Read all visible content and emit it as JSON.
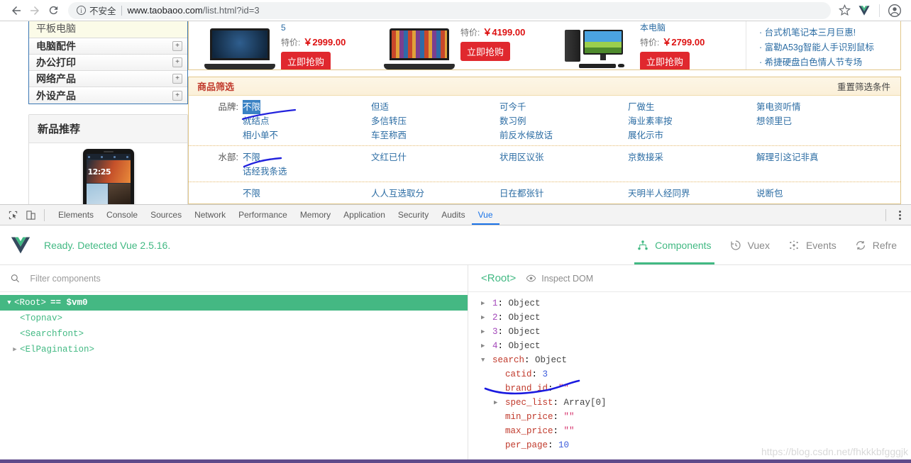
{
  "browser": {
    "back_icon": "arrow-left-icon",
    "forward_icon": "arrow-right-icon",
    "reload_icon": "reload-icon",
    "info_icon": "info-circle-icon",
    "security_label": "不安全",
    "url_host": "www.taobaoo.com",
    "url_path": "/list.html?id=3",
    "bookmark_icon": "star-icon",
    "extension_icon": "vue-devtools-extension-icon",
    "profile_icon": "profile-avatar-icon"
  },
  "sidebar": {
    "first_item": "平板电脑",
    "categories": [
      {
        "label": "电脑配件",
        "expand": "+"
      },
      {
        "label": "办公打印",
        "expand": "+"
      },
      {
        "label": "网络产品",
        "expand": "+"
      },
      {
        "label": "外设产品",
        "expand": "+"
      }
    ],
    "new_products": {
      "title": "新品推荐",
      "tablet_clock": "12:25"
    }
  },
  "promos": {
    "items": [
      {
        "name": "5",
        "price_label": "特价:",
        "price": "￥2999.00",
        "buy_label": "立即抢购",
        "art": "laptop-blue"
      },
      {
        "name": "",
        "price_label": "特价:",
        "price": "￥4199.00",
        "buy_label": "立即抢购",
        "art": "laptop-color"
      },
      {
        "name": "本电脑",
        "price_label": "特价:",
        "price": "￥2799.00",
        "buy_label": "立即抢购",
        "art": "desktop"
      }
    ],
    "side_links": [
      "台式机笔记本三月巨惠!",
      "富勒A53g智能人手识别鼠标",
      "希捷硬盘白色情人节专场"
    ]
  },
  "filter": {
    "title": "商品筛选",
    "reset_label": "重置筛选条件",
    "rows": [
      {
        "label": "品牌:",
        "columns": [
          {
            "options": [
              "不限",
              "就结点",
              "相小单不"
            ],
            "selected_index": 0
          },
          {
            "options": [
              "但适",
              "多信转压",
              "车至称西"
            ],
            "selected_index": -1
          },
          {
            "options": [
              "可今千",
              "数习例",
              "前反水候放话"
            ],
            "selected_index": -1
          },
          {
            "options": [
              "厂做生",
              "海业素率按",
              "展化示市"
            ],
            "selected_index": -1
          },
          {
            "options": [
              "第电资听情",
              "想领里已"
            ],
            "selected_index": -1
          }
        ]
      },
      {
        "label": "水部:",
        "columns": [
          {
            "options": [
              "不限",
              "话经我条选"
            ],
            "selected_index": -1
          },
          {
            "options": [
              "文红已什"
            ],
            "selected_index": -1
          },
          {
            "options": [
              "状用区议张"
            ],
            "selected_index": -1
          },
          {
            "options": [
              "京数接采"
            ],
            "selected_index": -1
          },
          {
            "options": [
              "解理引这记非真"
            ],
            "selected_index": -1
          }
        ]
      },
      {
        "label": "",
        "columns": [
          {
            "options": [
              "不限"
            ],
            "selected_index": -1
          },
          {
            "options": [
              "人人互选取分"
            ],
            "selected_index": -1
          },
          {
            "options": [
              "日在都张针"
            ],
            "selected_index": -1
          },
          {
            "options": [
              "天明半人经同界"
            ],
            "selected_index": -1
          },
          {
            "options": [
              "说断包"
            ],
            "selected_index": -1
          }
        ]
      }
    ]
  },
  "devtools": {
    "inspect_icon": "inspect-element-icon",
    "device_icon": "device-toolbar-icon",
    "tabs": [
      "Elements",
      "Console",
      "Sources",
      "Network",
      "Performance",
      "Memory",
      "Application",
      "Security",
      "Audits",
      "Vue"
    ],
    "active_tab": "Vue",
    "more_icon": "more-vertical-icon"
  },
  "vue_panel": {
    "logo_icon": "vue-logo-icon",
    "status": "Ready. Detected Vue 2.5.16.",
    "tabs": [
      {
        "label": "Components",
        "icon": "components-tree-icon",
        "active": true
      },
      {
        "label": "Vuex",
        "icon": "vuex-clock-icon",
        "active": false
      },
      {
        "label": "Events",
        "icon": "events-scatter-icon",
        "active": false
      },
      {
        "label": "Refre",
        "icon": "refresh-icon",
        "active": false
      }
    ],
    "filter_placeholder": "Filter components",
    "filter_value": "",
    "search_icon": "search-icon",
    "tree": [
      {
        "name": "<Root>",
        "suffix": "== $vm0",
        "selected": true,
        "arrow": "▼",
        "depth": 0
      },
      {
        "name": "<Topnav>",
        "suffix": "",
        "selected": false,
        "arrow": "",
        "depth": 1
      },
      {
        "name": "<Searchfont>",
        "suffix": "",
        "selected": false,
        "arrow": "",
        "depth": 1
      },
      {
        "name": "<ElPagination>",
        "suffix": "",
        "selected": false,
        "arrow": "▶",
        "depth": 1
      }
    ],
    "inspector": {
      "component": "<Root>",
      "inspect_dom_label": "Inspect DOM",
      "eye_icon": "eye-icon",
      "rows": [
        {
          "arrow": "▶",
          "key": "1",
          "key_type": "num",
          "value": "Object",
          "value_type": "type",
          "depth": 1
        },
        {
          "arrow": "▶",
          "key": "2",
          "key_type": "num",
          "value": "Object",
          "value_type": "type",
          "depth": 1
        },
        {
          "arrow": "▶",
          "key": "3",
          "key_type": "num",
          "value": "Object",
          "value_type": "type",
          "depth": 1
        },
        {
          "arrow": "▶",
          "key": "4",
          "key_type": "num",
          "value": "Object",
          "value_type": "type",
          "depth": 1
        },
        {
          "arrow": "▼",
          "key": "search",
          "key_type": "key",
          "value": "Object",
          "value_type": "type",
          "depth": 1
        },
        {
          "arrow": "",
          "key": "catid",
          "key_type": "key",
          "value": "3",
          "value_type": "num",
          "depth": 2
        },
        {
          "arrow": "",
          "key": "brand_id",
          "key_type": "key",
          "value": "\"\"",
          "value_type": "str",
          "depth": 2
        },
        {
          "arrow": "▶",
          "key": "spec_list",
          "key_type": "key",
          "value": "Array[0]",
          "value_type": "type",
          "depth": 2
        },
        {
          "arrow": "",
          "key": "min_price",
          "key_type": "key",
          "value": "\"\"",
          "value_type": "str",
          "depth": 2
        },
        {
          "arrow": "",
          "key": "max_price",
          "key_type": "key",
          "value": "\"\"",
          "value_type": "str",
          "depth": 2
        },
        {
          "arrow": "",
          "key": "per_page",
          "key_type": "key",
          "value": "10",
          "value_type": "num",
          "depth": 2
        }
      ]
    },
    "watermark": "https://blog.csdn.net/fhkkkbfgggjk"
  },
  "colors": {
    "vue_green": "#42b983",
    "chrome_blue": "#1a73e8",
    "price_red": "#dd1111",
    "buy_red": "#e0282e",
    "link_blue": "#2b6ca3",
    "pen_blue": "#1a1ae0"
  }
}
